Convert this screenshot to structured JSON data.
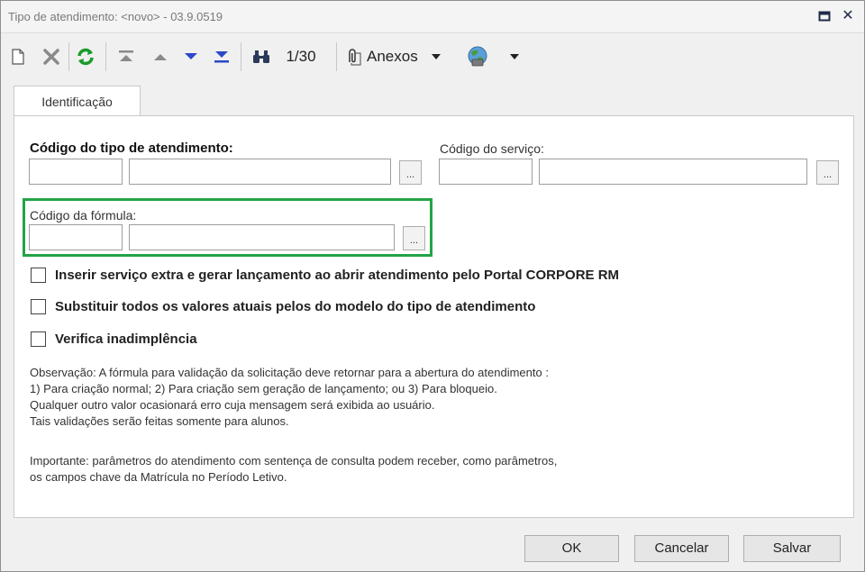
{
  "window": {
    "title": "Tipo de atendimento: <novo> - 03.9.0519",
    "maximize_glyph": "◘",
    "close_glyph": "✕"
  },
  "toolbar": {
    "record_counter": "1/30",
    "attachments_label": "Anexos",
    "icons": [
      "new-record-icon",
      "delete-icon",
      "refresh-icon",
      "first-record-icon",
      "previous-record-icon",
      "next-record-icon",
      "last-record-icon",
      "binoculars-icon",
      "paperclip-icon",
      "globe-icon"
    ],
    "refresh_color": "#1a9a2a",
    "nav_color": "#2a48c8"
  },
  "tabs": [
    {
      "label": "Identificação",
      "active": true
    }
  ],
  "form": {
    "tipo_atendimento_label": "Código do tipo de atendimento:",
    "servico_label": "Código do serviço:",
    "formula_label": "Código da fórmula:",
    "lookup_glyph": "..."
  },
  "checkboxes": [
    {
      "label": "Inserir serviço extra e gerar lançamento ao abrir atendimento pelo Portal CORPORE RM",
      "checked": false
    },
    {
      "label": "Substituir todos os valores atuais pelos do modelo do tipo de atendimento",
      "checked": false
    },
    {
      "label": "Verifica inadimplência",
      "checked": false
    }
  ],
  "notes": {
    "line1": "Observação: A fórmula para validação da solicitação deve retornar para a abertura do atendimento :",
    "line2": "1) Para criação normal;  2) Para criação sem geração de lançamento;  ou 3) Para bloqueio.",
    "line3": "Qualquer outro valor ocasionará erro cuja mensagem será exibida ao usuário.",
    "line4": "Tais validações serão feitas somente para alunos.",
    "line5": "Importante: parâmetros do atendimento com sentença de consulta podem receber, como parâmetros,",
    "line6": "os campos chave da Matrícula no Período Letivo."
  },
  "buttons": {
    "ok": "OK",
    "cancel": "Cancelar",
    "save": "Salvar"
  },
  "highlight_color": "#23a447"
}
